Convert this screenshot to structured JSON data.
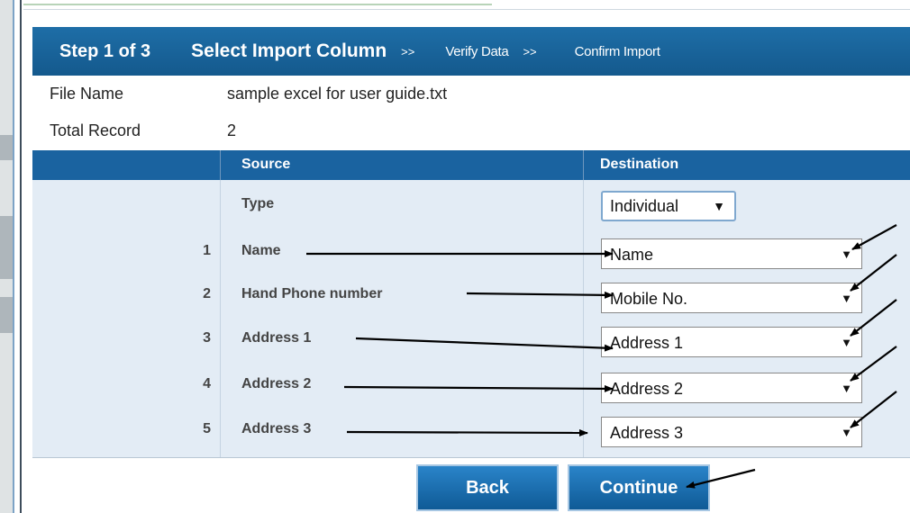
{
  "wizard": {
    "step_label": "Step 1 of 3",
    "current_step": "Select Import Column",
    "separator": ">>",
    "next_step": "Verify Data",
    "final_step": "Confirm Import"
  },
  "file_info": {
    "file_name_label": "File Name",
    "file_name_value": "sample excel for user guide.txt",
    "total_record_label": "Total Record",
    "total_record_value": "2"
  },
  "mapping_table": {
    "headers": {
      "source": "Source",
      "destination": "Destination"
    },
    "type_row": {
      "label": "Type",
      "selected": "Individual"
    },
    "rows": [
      {
        "num": "1",
        "source": "Name",
        "destination": "Name"
      },
      {
        "num": "2",
        "source": "Hand Phone number",
        "destination": "Mobile No."
      },
      {
        "num": "3",
        "source": "Address 1",
        "destination": "Address 1"
      },
      {
        "num": "4",
        "source": "Address 2",
        "destination": "Address 2"
      },
      {
        "num": "5",
        "source": "Address 3",
        "destination": "Address 3"
      }
    ]
  },
  "buttons": {
    "back": "Back",
    "continue": "Continue"
  },
  "icons": {
    "dropdown": "caret-down-icon",
    "annotation": "arrow-annotation"
  },
  "colors": {
    "header_blue": "#1a63a0",
    "body_light": "#e3ecf5",
    "button_blue": "#1e72b5"
  }
}
